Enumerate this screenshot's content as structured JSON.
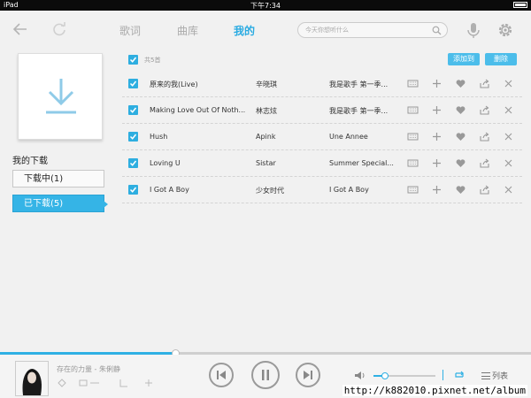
{
  "status_bar": {
    "device": "iPad",
    "time": "下午7:34"
  },
  "nav": {
    "tabs": [
      {
        "label": "歌词"
      },
      {
        "label": "曲库"
      },
      {
        "label": "我的"
      }
    ],
    "search_placeholder": "今天你想听什么"
  },
  "sidebar": {
    "section_title": "我的下载",
    "downloading_label": "下载中(1)",
    "downloaded_label": "已下载(5)"
  },
  "list_header": {
    "count_label": "共5首",
    "add_to_label": "添加到",
    "delete_label": "删除"
  },
  "songs": [
    {
      "title": "原来的我(Live)",
      "artist": "辛晓琪",
      "album": "我是歌手 第一季..."
    },
    {
      "title": "Making Love Out Of Noth...",
      "artist": "林志炫",
      "album": "我是歌手 第一季..."
    },
    {
      "title": "Hush",
      "artist": "Apink",
      "album": "Une Annee"
    },
    {
      "title": "Loving U",
      "artist": "Sistar",
      "album": "Summer Special..."
    },
    {
      "title": "I Got A Boy",
      "artist": "少女时代",
      "album": "I Got A Boy"
    }
  ],
  "player": {
    "now_playing": "存在的力量 - 朱俐静",
    "progress": 0.33,
    "volume": 0.18,
    "playlist_label": "列表"
  },
  "watermark": "http://k882010.pixnet.net/album",
  "colors": {
    "accent": "#29abe2",
    "selected_button": "#35b4e6"
  }
}
